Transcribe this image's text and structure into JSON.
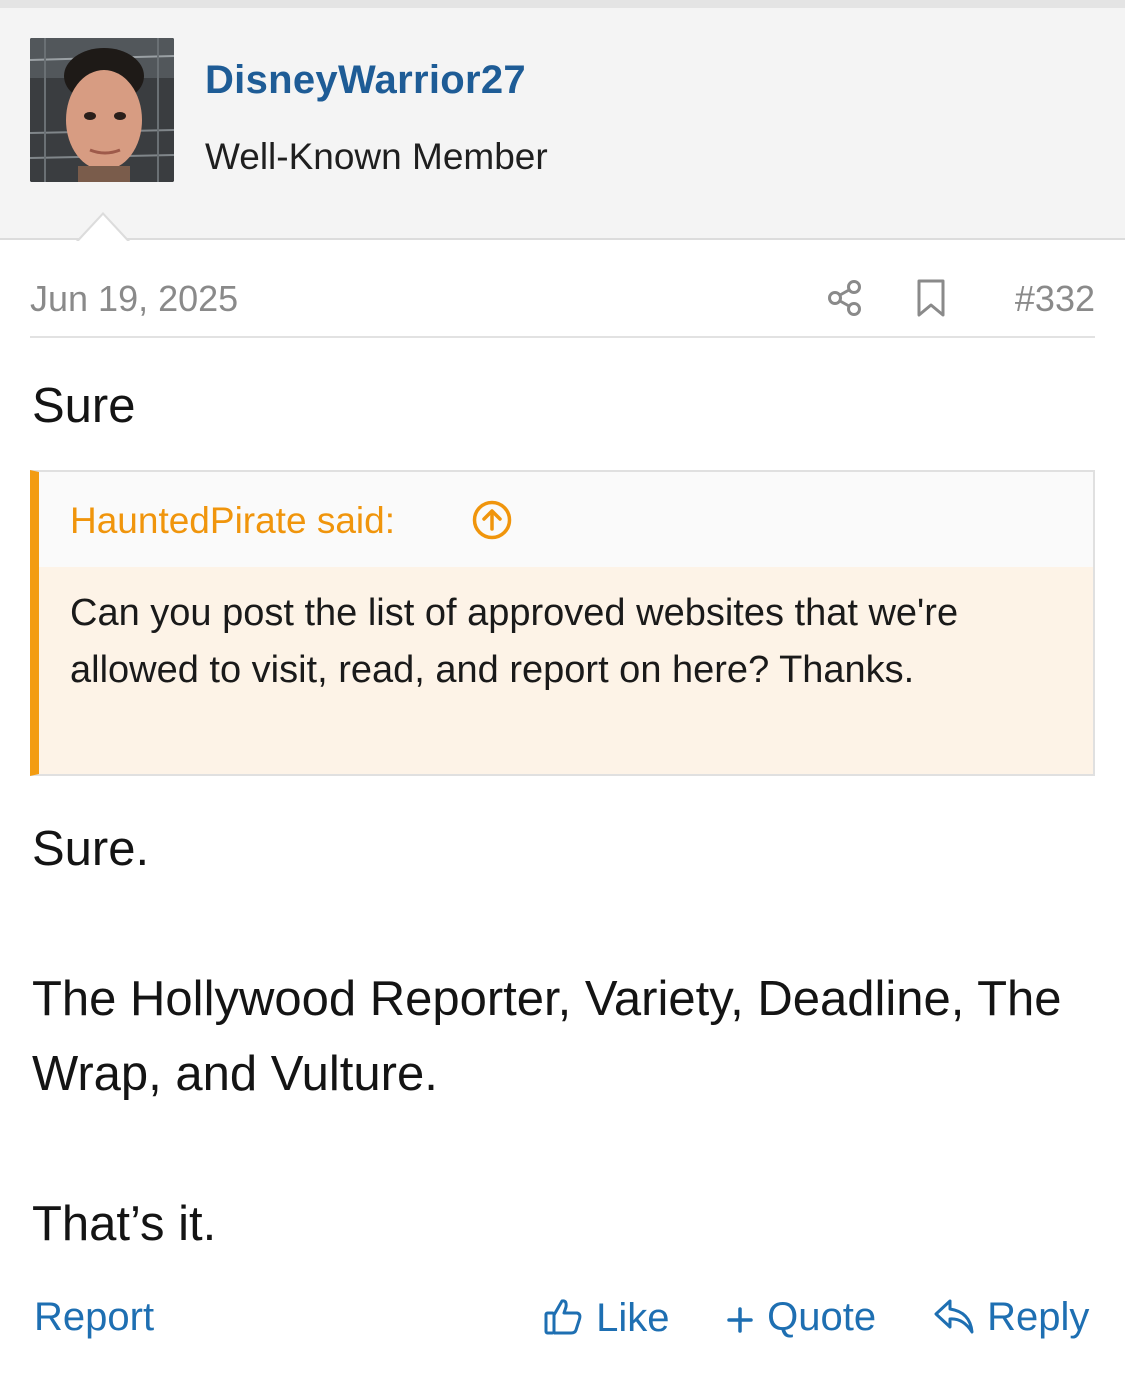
{
  "author": {
    "username": "DisneyWarrior27",
    "title": "Well-Known Member"
  },
  "post": {
    "date": "Jun 19, 2025",
    "number": "#332",
    "intro": "Sure",
    "quote": {
      "author_label": "HauntedPirate said:",
      "text": "Can you post the list of approved websites that we're allowed to visit, read, and report on here? Thanks."
    },
    "reply": {
      "line1": "Sure.",
      "line2": "The Hollywood Reporter, Variety, Deadline, The Wrap, and Vulture.",
      "line3": "That’s it."
    }
  },
  "actions": {
    "report": "Report",
    "like": "Like",
    "quote": "Quote",
    "reply": "Reply"
  },
  "colors": {
    "link": "#1e6fb2",
    "username": "#1e5c96",
    "quote_accent": "#f39c12",
    "quote_bg": "#fdf3e7"
  },
  "icons": [
    "share-icon",
    "bookmark-icon",
    "up-arrow-circle-icon",
    "thumbs-up-icon",
    "plus-icon",
    "reply-arrow-icon"
  ]
}
